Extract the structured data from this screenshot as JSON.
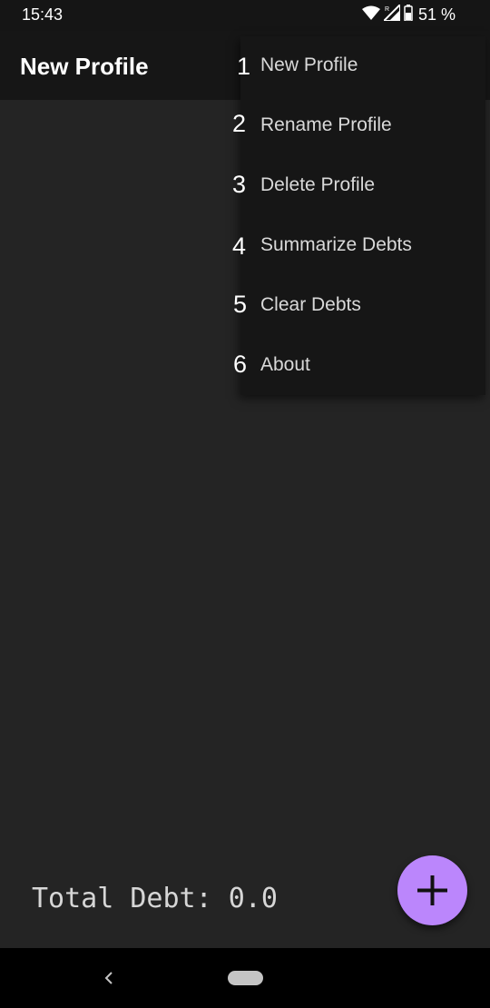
{
  "status_bar": {
    "time": "15:43",
    "battery_text": "51 %",
    "icons": [
      "wifi-icon",
      "signal-icon",
      "battery-icon"
    ]
  },
  "app_bar": {
    "title": "New Profile"
  },
  "overflow_menu": {
    "items": [
      {
        "number": "1",
        "label": "New Profile"
      },
      {
        "number": "2",
        "label": "Rename Profile"
      },
      {
        "number": "3",
        "label": "Delete Profile"
      },
      {
        "number": "4",
        "label": "Summarize Debts"
      },
      {
        "number": "5",
        "label": "Clear Debts"
      },
      {
        "number": "6",
        "label": "About"
      }
    ]
  },
  "main": {
    "total_debt_text": "Total Debt: 0.0"
  },
  "fab": {
    "icon": "plus-icon",
    "color": "#bb86fc"
  },
  "nav_bar": {
    "icons": [
      "back-icon",
      "home-pill"
    ]
  }
}
